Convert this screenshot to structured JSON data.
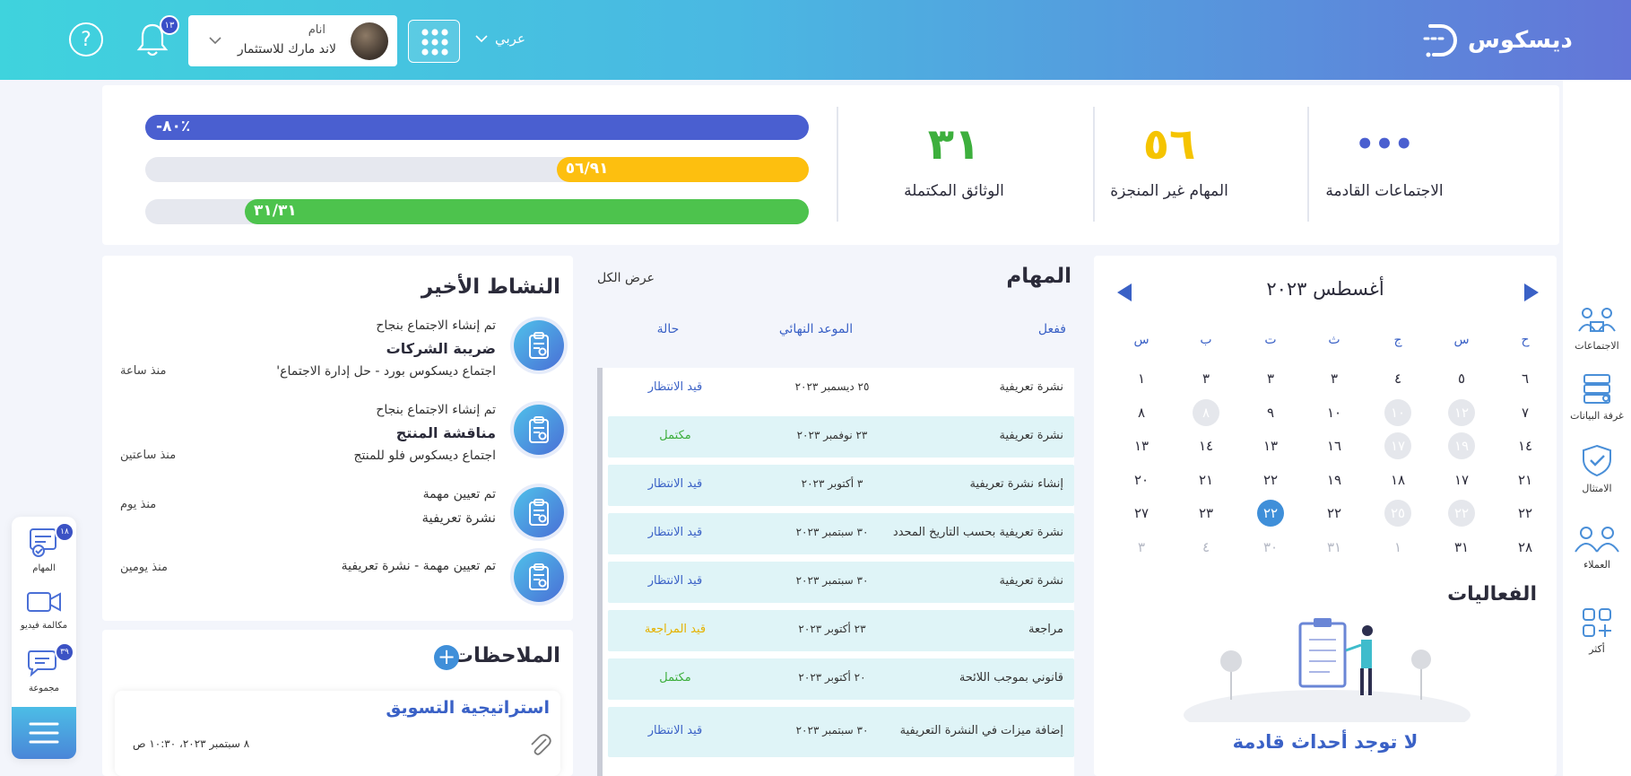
{
  "header": {
    "logo_text": "ديسكوس",
    "language": "عربي",
    "user_status": "انام",
    "user_name": "لاند مارك للاستثمار",
    "notifications_count": "١٣",
    "help": "?"
  },
  "dock": {
    "tasks_label": "المهام",
    "tasks_count": "١٨",
    "video_label": "مكالمة فيديو",
    "group_label": "مجموعة",
    "group_count": "٣٩"
  },
  "sidebar": {
    "items": [
      {
        "label": "الاجتماعات"
      },
      {
        "label": "غرفة البيانات"
      },
      {
        "label": "الامتثال"
      },
      {
        "label": "العملاء"
      },
      {
        "label": "أكثر"
      }
    ]
  },
  "stats": {
    "upcoming_meetings": {
      "value": "•••",
      "label": "الاجتماعات القادمة"
    },
    "pending_tasks": {
      "value": "٥٦",
      "label": "المهام غير المنجزة"
    },
    "completed_docs": {
      "value": "٣١",
      "label": "الوثائق المكتملة"
    },
    "bars": [
      {
        "text": "-٨٠٪",
        "fraction": 1.0,
        "color": "#4a5fd0"
      },
      {
        "text": "٥٦/٩١",
        "fraction": 0.38,
        "color": "#fdbf0f"
      },
      {
        "text": "٣١/٣١",
        "fraction": 0.85,
        "color": "#4dc34d"
      }
    ]
  },
  "activity": {
    "title": "النشاط الأخير",
    "items": [
      {
        "line1": "تم إنشاء الاجتماع بنجاح",
        "line2": "ضريبة الشركات",
        "line3": "اجتماع ديسكوس بورد - حل إدارة الاجتماع'",
        "time": "منذ ساعة"
      },
      {
        "line1": "تم إنشاء الاجتماع بنجاح",
        "line2": "مناقشة المنتج",
        "line3": "اجتماع ديسكوس فلو للمنتج",
        "time": "منذ ساعتين"
      },
      {
        "line1": "تم تعيين مهمة",
        "line2": "نشرة تعريفية",
        "line3": "",
        "time": "منذ يوم"
      },
      {
        "line1": "تم تعيين مهمة - نشرة تعريفية",
        "line2": "",
        "line3": "",
        "time": "منذ يومين"
      }
    ]
  },
  "notes": {
    "title": "الملاحظات",
    "add": "+",
    "note_title": "استراتيجية التسويق",
    "note_date": "٨ سبتمبر ٢٠٢٣، ١٠:٣٠ ص"
  },
  "tasks": {
    "title": "المهام",
    "view_all": "عرض الكل",
    "col_action": "ففعل",
    "col_deadline": "الموعد النهائي",
    "col_status": "حالة",
    "colors": {
      "pending": "#3a61c6",
      "done": "#3daf3d",
      "review": "#e5b200"
    },
    "rows": [
      {
        "name": "نشرة تعريفية",
        "date": "٢٥ ديسمبر ٢٠٢٣",
        "status": "قيد الانتظار",
        "kind": "pending"
      },
      {
        "name": "نشرة تعريفية",
        "date": "٢٣ نوفمبر ٢٠٢٣",
        "status": "مكتمل",
        "kind": "done"
      },
      {
        "name": "إنشاء نشرة تعريفية",
        "date": "٣ أكتوبر ٢٠٢٣",
        "status": "قيد الانتظار",
        "kind": "pending"
      },
      {
        "name": "نشرة تعريفية بحسب التاريخ المحدد",
        "date": "٣٠ سبتمبر ٢٠٢٣",
        "status": "قيد الانتظار",
        "kind": "pending"
      },
      {
        "name": "نشرة تعريفية",
        "date": "٣٠ سبتمبر ٢٠٢٣",
        "status": "قيد الانتظار",
        "kind": "pending"
      },
      {
        "name": "مراجعة",
        "date": "٢٣ أكتوبر ٢٠٢٣",
        "status": "قيد المراجعة",
        "kind": "review"
      },
      {
        "name": "قانوني بموجب اللائحة",
        "date": "٢٠ أكتوبر ٢٠٢٣",
        "status": "مكتمل",
        "kind": "done"
      },
      {
        "name": "إضافة ميزات في النشرة التعريفية",
        "date": "٣٠ سبتمبر ٢٠٢٣",
        "status": "قيد الانتظار",
        "kind": "pending"
      }
    ]
  },
  "calendar": {
    "month": "أغسطس ٢٠٢٣",
    "weekdays": [
      "ح",
      "س",
      "ج",
      "ث",
      "ت",
      "ب",
      "س"
    ],
    "weeks": [
      [
        {
          "d": "٦"
        },
        {
          "d": "٥"
        },
        {
          "d": "٤"
        },
        {
          "d": "٣"
        },
        {
          "d": "٣"
        },
        {
          "d": "٣"
        },
        {
          "d": "١"
        }
      ],
      [
        {
          "d": "٧"
        },
        {
          "d": "١٢",
          "s": "past"
        },
        {
          "d": "١٠",
          "s": "past"
        },
        {
          "d": "١٠"
        },
        {
          "d": "٩"
        },
        {
          "d": "٨",
          "s": "past"
        },
        {
          "d": "٨"
        }
      ],
      [
        {
          "d": "١٤"
        },
        {
          "d": "١٩",
          "s": "past"
        },
        {
          "d": "١٧",
          "s": "past"
        },
        {
          "d": "١٦"
        },
        {
          "d": "١٣"
        },
        {
          "d": "١٤"
        },
        {
          "d": "١٣"
        }
      ],
      [
        {
          "d": "٢١"
        },
        {
          "d": "١٧"
        },
        {
          "d": "١٨"
        },
        {
          "d": "١٩"
        },
        {
          "d": "٢٢"
        },
        {
          "d": "٢١"
        },
        {
          "d": "٢٠"
        }
      ],
      [
        {
          "d": "٢٢"
        },
        {
          "d": "٢٢",
          "s": "past"
        },
        {
          "d": "٢٥",
          "s": "past"
        },
        {
          "d": "٢٢"
        },
        {
          "d": "٢٢",
          "s": "today"
        },
        {
          "d": "٢٣"
        },
        {
          "d": "٢٧"
        }
      ],
      [
        {
          "d": "٢٨"
        },
        {
          "d": "٣١"
        },
        {
          "d": "١",
          "s": "muted"
        },
        {
          "d": "٣١",
          "s": "muted"
        },
        {
          "d": "٣٠",
          "s": "muted"
        },
        {
          "d": "٤",
          "s": "muted"
        },
        {
          "d": "٣",
          "s": "muted"
        }
      ]
    ],
    "events_title": "الفعاليات",
    "no_events": "لا توجد أحداث قادمة"
  }
}
